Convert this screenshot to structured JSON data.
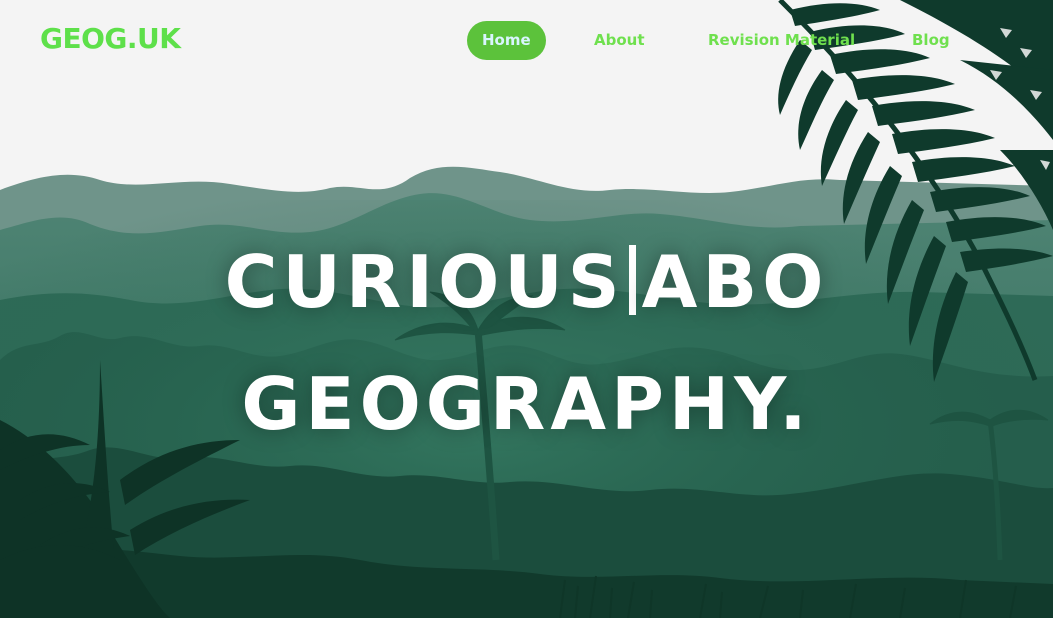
{
  "header": {
    "logo": "GEOG.UK"
  },
  "nav": {
    "items": [
      {
        "label": "Home",
        "active": true
      },
      {
        "label": "About",
        "active": false
      },
      {
        "label": "Revision Material",
        "active": false
      },
      {
        "label": "Blog",
        "active": false
      }
    ]
  },
  "hero": {
    "line1_typed": "CURIOUS",
    "line1_rest": "ABO",
    "line2": "GEOGRAPHY."
  },
  "colors": {
    "accent_green": "#5ee04a",
    "active_pill": "#5cc23b",
    "background": "#f4f4f4",
    "forest_dark": "#0f3a2a",
    "forest_mid": "#1f5c46",
    "mountain_far": "#6b8f83"
  }
}
